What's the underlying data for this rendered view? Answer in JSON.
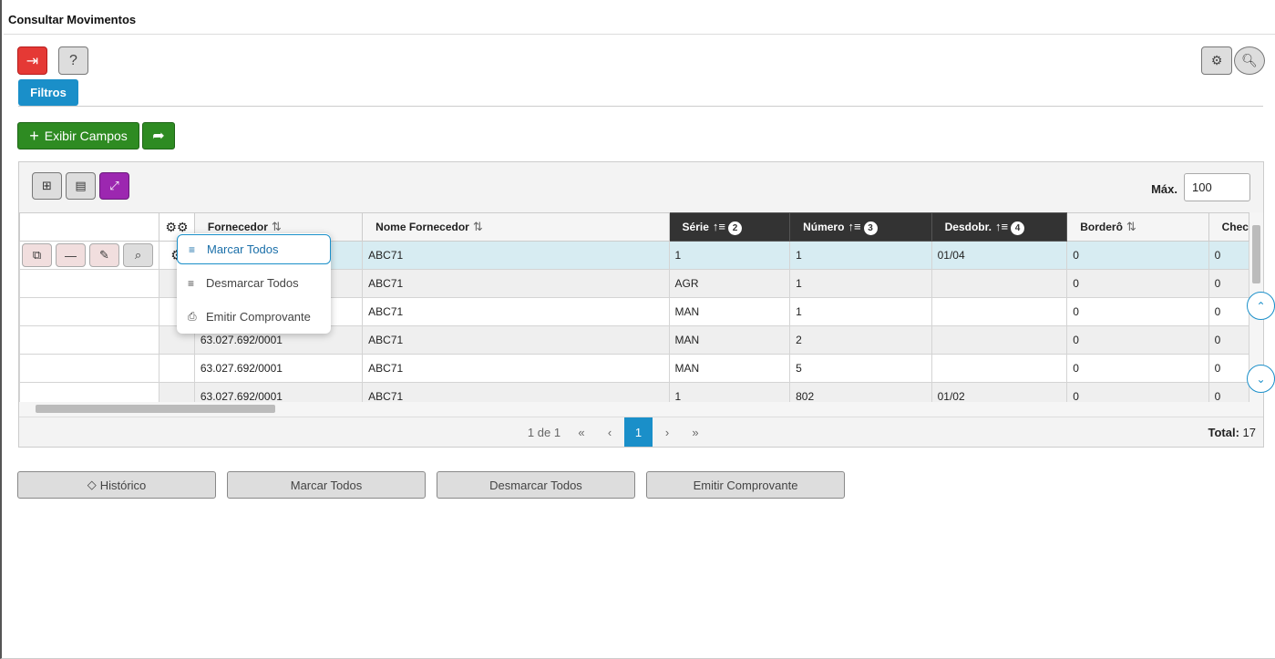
{
  "page": {
    "title": "Consultar Movimentos"
  },
  "toolbar": {
    "filtros_label": "Filtros",
    "exibir_campos_label": "Exibir Campos"
  },
  "grid": {
    "max_label": "Máx.",
    "max_value": "100",
    "columns": [
      {
        "label": "Fornecedor",
        "sort": "⇅"
      },
      {
        "label": "Nome Fornecedor",
        "sort": "⇅"
      },
      {
        "label": "Série",
        "sort": "↑≡",
        "badge": "2"
      },
      {
        "label": "Número",
        "sort": "↑≡",
        "badge": "3"
      },
      {
        "label": "Desdobr.",
        "sort": "↑≡",
        "badge": "4"
      },
      {
        "label": "Borderô",
        "sort": "⇅"
      },
      {
        "label": "Chec"
      }
    ],
    "rows": [
      [
        "",
        "ABC71",
        "1",
        "1",
        "01/04",
        "0",
        "0"
      ],
      [
        "",
        "ABC71",
        "AGR",
        "1",
        "",
        "0",
        "0"
      ],
      [
        "",
        "ABC71",
        "MAN",
        "1",
        "",
        "0",
        "0"
      ],
      [
        "63.027.692/0001",
        "ABC71",
        "MAN",
        "2",
        "",
        "0",
        "0"
      ],
      [
        "63.027.692/0001",
        "ABC71",
        "MAN",
        "5",
        "",
        "0",
        "0"
      ],
      [
        "63.027.692/0001",
        "ABC71",
        "1",
        "802",
        "01/02",
        "0",
        "0"
      ]
    ]
  },
  "pager": {
    "info": "1 de 1",
    "first": "«",
    "prev": "‹",
    "current": "1",
    "next": "›",
    "last": "»",
    "total_label": "Total:",
    "total_value": "17"
  },
  "context_menu": {
    "items": [
      "Marcar Todos",
      "Desmarcar Todos",
      "Emitir Comprovante"
    ]
  },
  "bottom": {
    "historico": "Histórico",
    "marcar": "Marcar Todos",
    "desmarcar": "Desmarcar Todos",
    "emitir": "Emitir Comprovante"
  }
}
